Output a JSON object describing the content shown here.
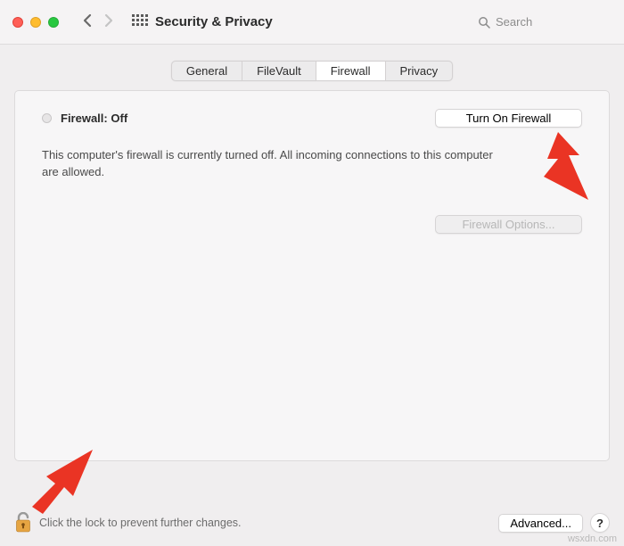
{
  "window": {
    "title": "Security & Privacy",
    "search_placeholder": "Search"
  },
  "tabs": [
    {
      "label": "General"
    },
    {
      "label": "FileVault"
    },
    {
      "label": "Firewall",
      "selected": true
    },
    {
      "label": "Privacy"
    }
  ],
  "firewall": {
    "status_label": "Firewall:",
    "status_value": "Off",
    "description": "This computer's firewall is currently turned off. All incoming connections to this computer are allowed.",
    "turn_on_label": "Turn On Firewall",
    "options_label": "Firewall Options..."
  },
  "footer": {
    "lock_text": "Click the lock to prevent further changes.",
    "advanced_label": "Advanced...",
    "help_label": "?"
  },
  "watermark": "wsxdn.com"
}
